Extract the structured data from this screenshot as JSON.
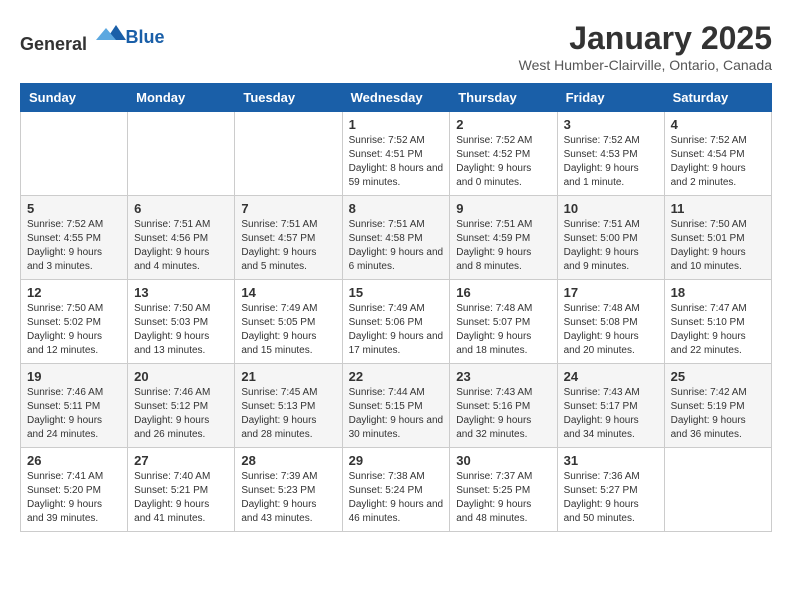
{
  "header": {
    "logo_general": "General",
    "logo_blue": "Blue",
    "title": "January 2025",
    "subtitle": "West Humber-Clairville, Ontario, Canada"
  },
  "weekdays": [
    "Sunday",
    "Monday",
    "Tuesday",
    "Wednesday",
    "Thursday",
    "Friday",
    "Saturday"
  ],
  "weeks": [
    [
      {
        "day": "",
        "info": ""
      },
      {
        "day": "",
        "info": ""
      },
      {
        "day": "",
        "info": ""
      },
      {
        "day": "1",
        "info": "Sunrise: 7:52 AM\nSunset: 4:51 PM\nDaylight: 8 hours and 59 minutes."
      },
      {
        "day": "2",
        "info": "Sunrise: 7:52 AM\nSunset: 4:52 PM\nDaylight: 9 hours and 0 minutes."
      },
      {
        "day": "3",
        "info": "Sunrise: 7:52 AM\nSunset: 4:53 PM\nDaylight: 9 hours and 1 minute."
      },
      {
        "day": "4",
        "info": "Sunrise: 7:52 AM\nSunset: 4:54 PM\nDaylight: 9 hours and 2 minutes."
      }
    ],
    [
      {
        "day": "5",
        "info": "Sunrise: 7:52 AM\nSunset: 4:55 PM\nDaylight: 9 hours and 3 minutes."
      },
      {
        "day": "6",
        "info": "Sunrise: 7:51 AM\nSunset: 4:56 PM\nDaylight: 9 hours and 4 minutes."
      },
      {
        "day": "7",
        "info": "Sunrise: 7:51 AM\nSunset: 4:57 PM\nDaylight: 9 hours and 5 minutes."
      },
      {
        "day": "8",
        "info": "Sunrise: 7:51 AM\nSunset: 4:58 PM\nDaylight: 9 hours and 6 minutes."
      },
      {
        "day": "9",
        "info": "Sunrise: 7:51 AM\nSunset: 4:59 PM\nDaylight: 9 hours and 8 minutes."
      },
      {
        "day": "10",
        "info": "Sunrise: 7:51 AM\nSunset: 5:00 PM\nDaylight: 9 hours and 9 minutes."
      },
      {
        "day": "11",
        "info": "Sunrise: 7:50 AM\nSunset: 5:01 PM\nDaylight: 9 hours and 10 minutes."
      }
    ],
    [
      {
        "day": "12",
        "info": "Sunrise: 7:50 AM\nSunset: 5:02 PM\nDaylight: 9 hours and 12 minutes."
      },
      {
        "day": "13",
        "info": "Sunrise: 7:50 AM\nSunset: 5:03 PM\nDaylight: 9 hours and 13 minutes."
      },
      {
        "day": "14",
        "info": "Sunrise: 7:49 AM\nSunset: 5:05 PM\nDaylight: 9 hours and 15 minutes."
      },
      {
        "day": "15",
        "info": "Sunrise: 7:49 AM\nSunset: 5:06 PM\nDaylight: 9 hours and 17 minutes."
      },
      {
        "day": "16",
        "info": "Sunrise: 7:48 AM\nSunset: 5:07 PM\nDaylight: 9 hours and 18 minutes."
      },
      {
        "day": "17",
        "info": "Sunrise: 7:48 AM\nSunset: 5:08 PM\nDaylight: 9 hours and 20 minutes."
      },
      {
        "day": "18",
        "info": "Sunrise: 7:47 AM\nSunset: 5:10 PM\nDaylight: 9 hours and 22 minutes."
      }
    ],
    [
      {
        "day": "19",
        "info": "Sunrise: 7:46 AM\nSunset: 5:11 PM\nDaylight: 9 hours and 24 minutes."
      },
      {
        "day": "20",
        "info": "Sunrise: 7:46 AM\nSunset: 5:12 PM\nDaylight: 9 hours and 26 minutes."
      },
      {
        "day": "21",
        "info": "Sunrise: 7:45 AM\nSunset: 5:13 PM\nDaylight: 9 hours and 28 minutes."
      },
      {
        "day": "22",
        "info": "Sunrise: 7:44 AM\nSunset: 5:15 PM\nDaylight: 9 hours and 30 minutes."
      },
      {
        "day": "23",
        "info": "Sunrise: 7:43 AM\nSunset: 5:16 PM\nDaylight: 9 hours and 32 minutes."
      },
      {
        "day": "24",
        "info": "Sunrise: 7:43 AM\nSunset: 5:17 PM\nDaylight: 9 hours and 34 minutes."
      },
      {
        "day": "25",
        "info": "Sunrise: 7:42 AM\nSunset: 5:19 PM\nDaylight: 9 hours and 36 minutes."
      }
    ],
    [
      {
        "day": "26",
        "info": "Sunrise: 7:41 AM\nSunset: 5:20 PM\nDaylight: 9 hours and 39 minutes."
      },
      {
        "day": "27",
        "info": "Sunrise: 7:40 AM\nSunset: 5:21 PM\nDaylight: 9 hours and 41 minutes."
      },
      {
        "day": "28",
        "info": "Sunrise: 7:39 AM\nSunset: 5:23 PM\nDaylight: 9 hours and 43 minutes."
      },
      {
        "day": "29",
        "info": "Sunrise: 7:38 AM\nSunset: 5:24 PM\nDaylight: 9 hours and 46 minutes."
      },
      {
        "day": "30",
        "info": "Sunrise: 7:37 AM\nSunset: 5:25 PM\nDaylight: 9 hours and 48 minutes."
      },
      {
        "day": "31",
        "info": "Sunrise: 7:36 AM\nSunset: 5:27 PM\nDaylight: 9 hours and 50 minutes."
      },
      {
        "day": "",
        "info": ""
      }
    ]
  ]
}
